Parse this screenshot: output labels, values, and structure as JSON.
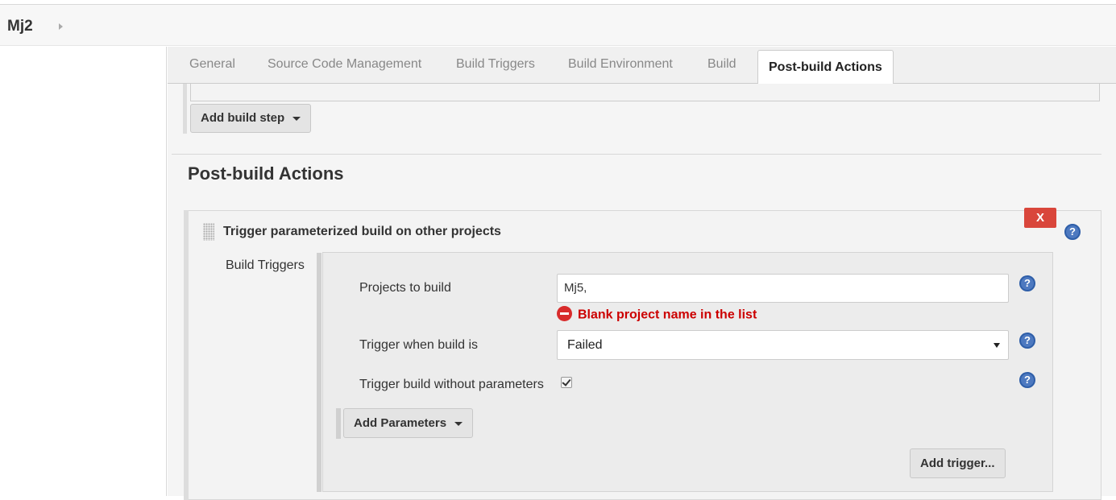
{
  "breadcrumb": {
    "job_name": "Mj2"
  },
  "tabs": [
    {
      "label": "General"
    },
    {
      "label": "Source Code Management"
    },
    {
      "label": "Build Triggers"
    },
    {
      "label": "Build Environment"
    },
    {
      "label": "Build"
    },
    {
      "label": "Post-build Actions",
      "active": true
    }
  ],
  "build": {
    "add_build_step_label": "Add build step"
  },
  "post_build": {
    "section_title": "Post-build Actions",
    "action_title": "Trigger parameterized build on other projects",
    "delete_label": "X",
    "build_triggers_label": "Build Triggers",
    "projects_label": "Projects to build",
    "projects_value": "Mj5,",
    "error_message": "Blank project name in the list",
    "trigger_when_label": "Trigger when build is",
    "trigger_when_value": "Failed",
    "without_params_label": "Trigger build without parameters",
    "without_params_checked": true,
    "add_parameters_label": "Add Parameters",
    "add_trigger_label": "Add trigger...",
    "help_glyph": "?"
  },
  "colors": {
    "error": "#cc0000",
    "delete_button": "#d9463b",
    "help_icon": "#4d79c0"
  },
  "icons": [
    "breadcrumb-arrow-icon",
    "drag-handle-icon",
    "help-icon",
    "error-icon",
    "caret-down-icon",
    "checkbox-checked-icon"
  ]
}
